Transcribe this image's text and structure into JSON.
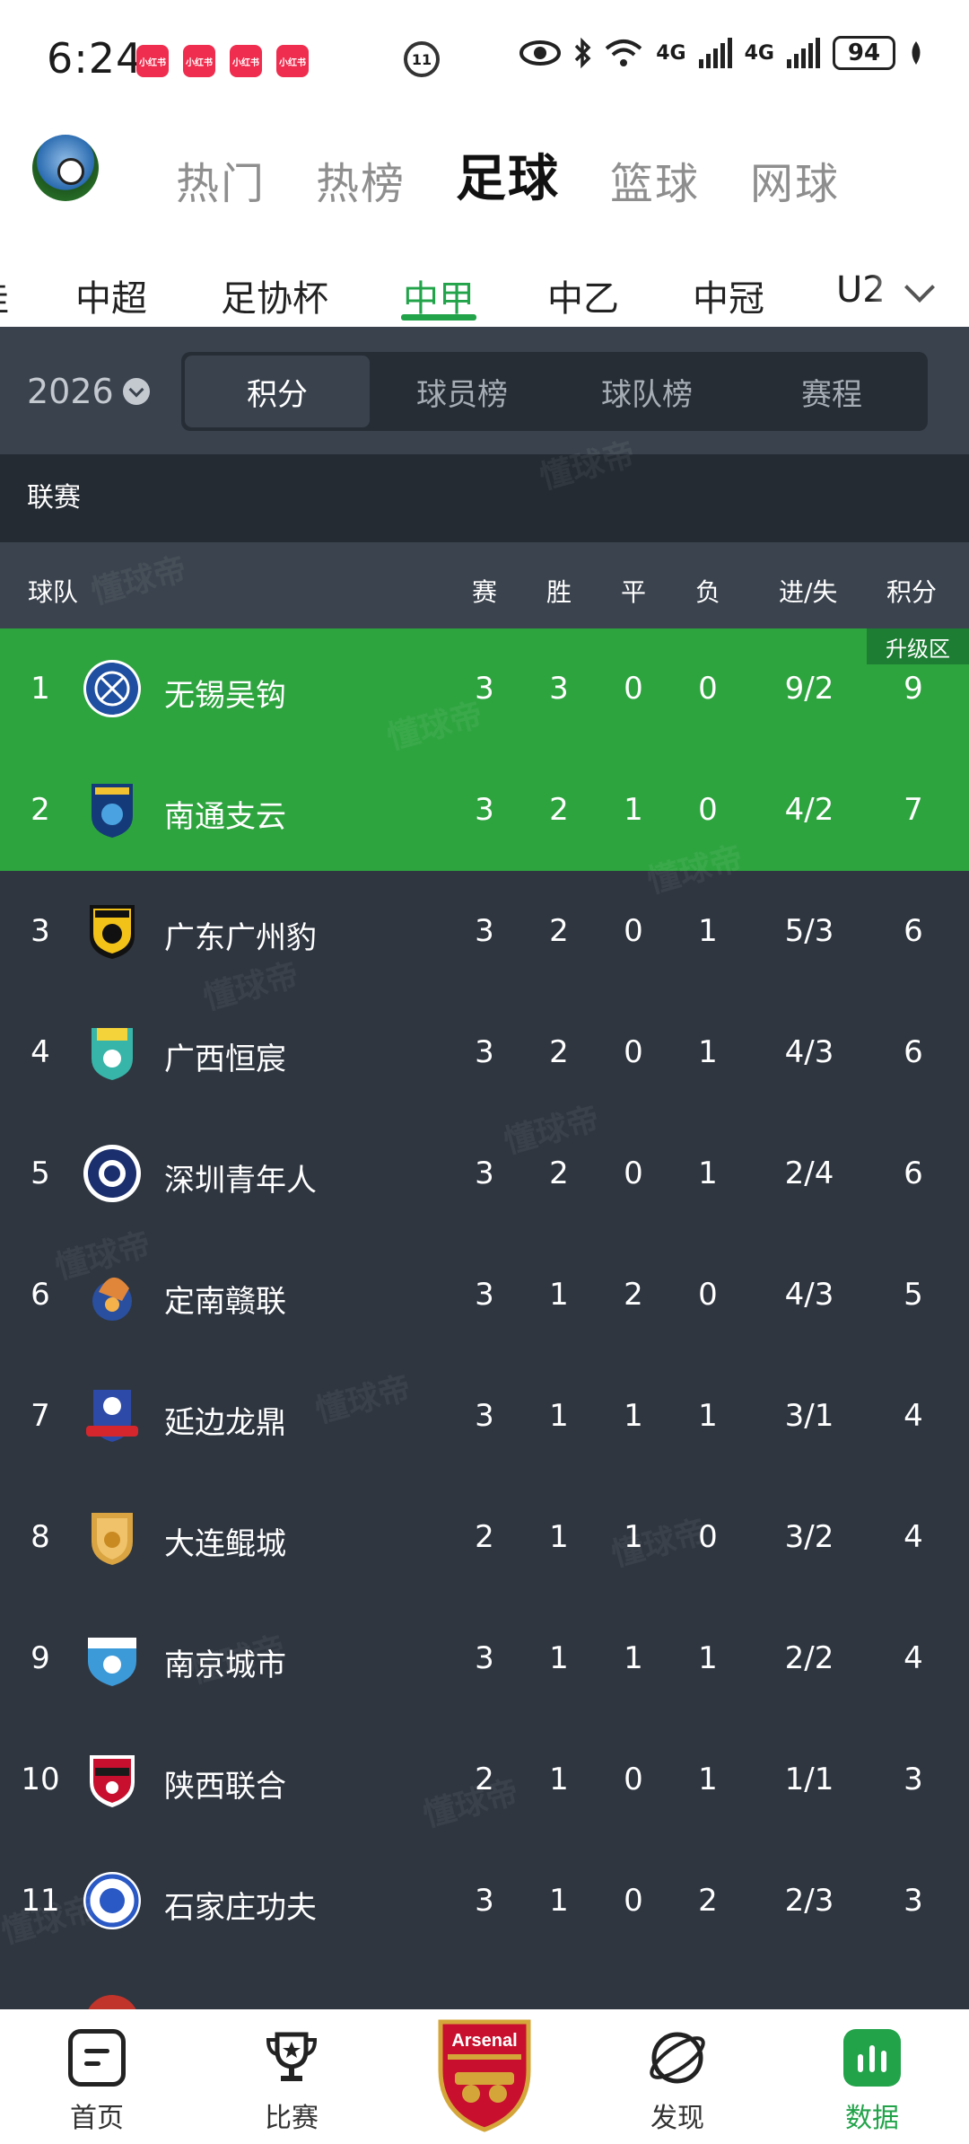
{
  "status_bar": {
    "time": "6:24",
    "notifications": [
      "小红书",
      "小红书",
      "小红书",
      "小红书"
    ],
    "mid_icon": "11",
    "signal_1": "4G",
    "signal_2": "4G",
    "battery": "94"
  },
  "main_tabs": [
    {
      "label": "热门",
      "active": false
    },
    {
      "label": "热榜",
      "active": false
    },
    {
      "label": "足球",
      "active": true
    },
    {
      "label": "篮球",
      "active": false
    },
    {
      "label": "网球",
      "active": false
    }
  ],
  "sub_tabs": [
    {
      "label": "洼",
      "active": false
    },
    {
      "label": "中超",
      "active": false
    },
    {
      "label": "足协杯",
      "active": false
    },
    {
      "label": "中甲",
      "active": true
    },
    {
      "label": "中乙",
      "active": false
    },
    {
      "label": "中冠",
      "active": false
    },
    {
      "label": "U2",
      "active": false
    }
  ],
  "filter": {
    "year": "2026",
    "segments": [
      {
        "label": "积分",
        "active": true
      },
      {
        "label": "球员榜",
        "active": false
      },
      {
        "label": "球队榜",
        "active": false
      },
      {
        "label": "赛程",
        "active": false
      }
    ]
  },
  "league_label": "联赛",
  "table_header": {
    "team": "球队",
    "played": "赛",
    "won": "胜",
    "drawn": "平",
    "lost": "负",
    "goals": "进/失",
    "points": "积分"
  },
  "promo_badge": "升级区",
  "rows": [
    {
      "rank": "1",
      "team": "无锡吴钩",
      "p": "3",
      "w": "3",
      "d": "0",
      "l": "0",
      "gd": "9/2",
      "pts": "9",
      "zone": "promotion",
      "logo": "wuxi-wugou-logo"
    },
    {
      "rank": "2",
      "team": "南通支云",
      "p": "3",
      "w": "2",
      "d": "1",
      "l": "0",
      "gd": "4/2",
      "pts": "7",
      "zone": "promotion",
      "logo": "nantong-zhiyun-logo"
    },
    {
      "rank": "3",
      "team": "广东广州豹",
      "p": "3",
      "w": "2",
      "d": "0",
      "l": "1",
      "gd": "5/3",
      "pts": "6",
      "zone": "",
      "logo": "guangzhou-leopard-logo"
    },
    {
      "rank": "4",
      "team": "广西恒宸",
      "p": "3",
      "w": "2",
      "d": "0",
      "l": "1",
      "gd": "4/3",
      "pts": "6",
      "zone": "",
      "logo": "guangxi-hengchen-logo"
    },
    {
      "rank": "5",
      "team": "深圳青年人",
      "p": "3",
      "w": "2",
      "d": "0",
      "l": "1",
      "gd": "2/4",
      "pts": "6",
      "zone": "",
      "logo": "shenzhen-youth-logo"
    },
    {
      "rank": "6",
      "team": "定南赣联",
      "p": "3",
      "w": "1",
      "d": "2",
      "l": "0",
      "gd": "4/3",
      "pts": "5",
      "zone": "",
      "logo": "dingnan-ganlian-logo"
    },
    {
      "rank": "7",
      "team": "延边龙鼎",
      "p": "3",
      "w": "1",
      "d": "1",
      "l": "1",
      "gd": "3/1",
      "pts": "4",
      "zone": "",
      "logo": "yanbian-longding-logo"
    },
    {
      "rank": "8",
      "team": "大连鲲城",
      "p": "2",
      "w": "1",
      "d": "1",
      "l": "0",
      "gd": "3/2",
      "pts": "4",
      "zone": "",
      "logo": "dalian-kuncheng-logo"
    },
    {
      "rank": "9",
      "team": "南京城市",
      "p": "3",
      "w": "1",
      "d": "1",
      "l": "1",
      "gd": "2/2",
      "pts": "4",
      "zone": "",
      "logo": "nanjing-city-logo"
    },
    {
      "rank": "10",
      "team": "陕西联合",
      "p": "2",
      "w": "1",
      "d": "0",
      "l": "1",
      "gd": "1/1",
      "pts": "3",
      "zone": "",
      "logo": "shaanxi-union-logo"
    },
    {
      "rank": "11",
      "team": "石家庄功夫",
      "p": "3",
      "w": "1",
      "d": "0",
      "l": "2",
      "gd": "2/3",
      "pts": "3",
      "zone": "",
      "logo": "shijiazhuang-kungfu-logo"
    }
  ],
  "watermark": "懂球帝",
  "bottom_nav": [
    {
      "label": "首页",
      "icon": "home-icon",
      "active": false
    },
    {
      "label": "比赛",
      "icon": "trophy-icon",
      "active": false
    },
    {
      "label": "",
      "icon": "arsenal-crest-icon",
      "active": false
    },
    {
      "label": "发现",
      "icon": "discover-icon",
      "active": false
    },
    {
      "label": "数据",
      "icon": "data-icon",
      "active": true
    }
  ],
  "crest_text": "Arsenal",
  "colors": {
    "accent": "#22a34a",
    "promotion_row": "#2ea43f",
    "table_bg": "#2f3640"
  }
}
